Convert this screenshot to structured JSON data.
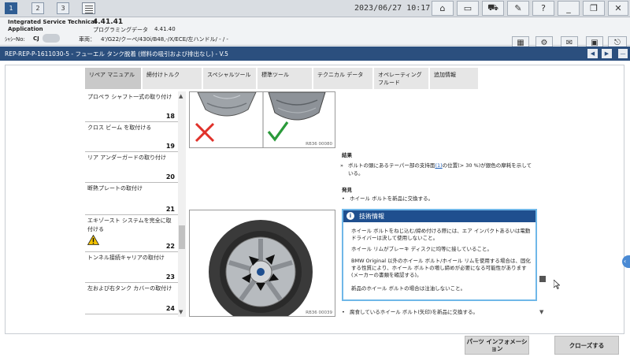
{
  "window_tabs": [
    "1",
    "2",
    "3"
  ],
  "app": {
    "name_line1": "Integrated Service Technical",
    "name_line2": "Application",
    "version": "4.41.41",
    "programming_data_label": "プログラミングデータ",
    "programming_data_version": "4.41.40"
  },
  "datetime": "2023/06/27 10:17:10",
  "vehicle": {
    "chassis_label": "ｼｬｼｰNo:",
    "chassis_value": "CJ",
    "vehicle_label": "車両：",
    "vehicle_value": "4'/G22/クーペ/430i/B48,-/X/ECE/左ハンドル/ - / -"
  },
  "title": "REP-REP-P-1611030-5 - フューエル タンク脱着 (燃料の吸引および排出なし) - V.5",
  "content_tabs": [
    "リペア マニュアル",
    "締付けトルク",
    "スペシャルツール",
    "標準ツール",
    "テクニカル データ",
    "オペレーティング フルード",
    "追加情報"
  ],
  "list_items": [
    {
      "label": "プロペラ シャフト一式の取り付け",
      "number": "18"
    },
    {
      "label": "クロス ビーム を取付ける",
      "number": "19"
    },
    {
      "label": "リア アンダーガードの取り付け",
      "number": "20"
    },
    {
      "label": "断熱プレートの取付け",
      "number": "21"
    },
    {
      "label": "エキゾースト システムを完全に取付ける",
      "number": "22"
    },
    {
      "label": "トンネル接続キャリアの取付け",
      "number": "23"
    },
    {
      "label": "左および右タンク カバーの取付け",
      "number": "24"
    }
  ],
  "images": [
    {
      "caption": "RB36 00080"
    },
    {
      "caption": "RB36 00039"
    }
  ],
  "result": {
    "heading": "結果",
    "text_before_link": "ボルトの頭にあるテーパー部の支持面",
    "link": "(1)",
    "text_after_link": "の位置(> 30 %)が銀色の摩耗を示している。"
  },
  "finding": {
    "heading": "発見",
    "bullet": "ホイール ボルトを新品に交換する。"
  },
  "note": {
    "title": "技術情報",
    "paragraphs": [
      "ホイール ボルトをねじ込む/締め付ける際には、エア インパクトあるいは電動ドライバーは決して使用しないこと。",
      "ホイール リムがブレーキ ディスクに均等に接していること。",
      "BMW Original 以外のホイール ボルト/ホイール リムを使用する場合は、固化する性質により、ホイール ボルトの増し締めが必要になる可能性があります(メーカーの書類を確認する)。",
      "新品のホイール ボルトの場合は注油しないこと。"
    ]
  },
  "bottom_bullet": "腐食しているホイール ボルト(矢印)を新品に交換する。",
  "buttons": {
    "parts_info": "パーツ インフォメーション",
    "close": "クローズする"
  }
}
